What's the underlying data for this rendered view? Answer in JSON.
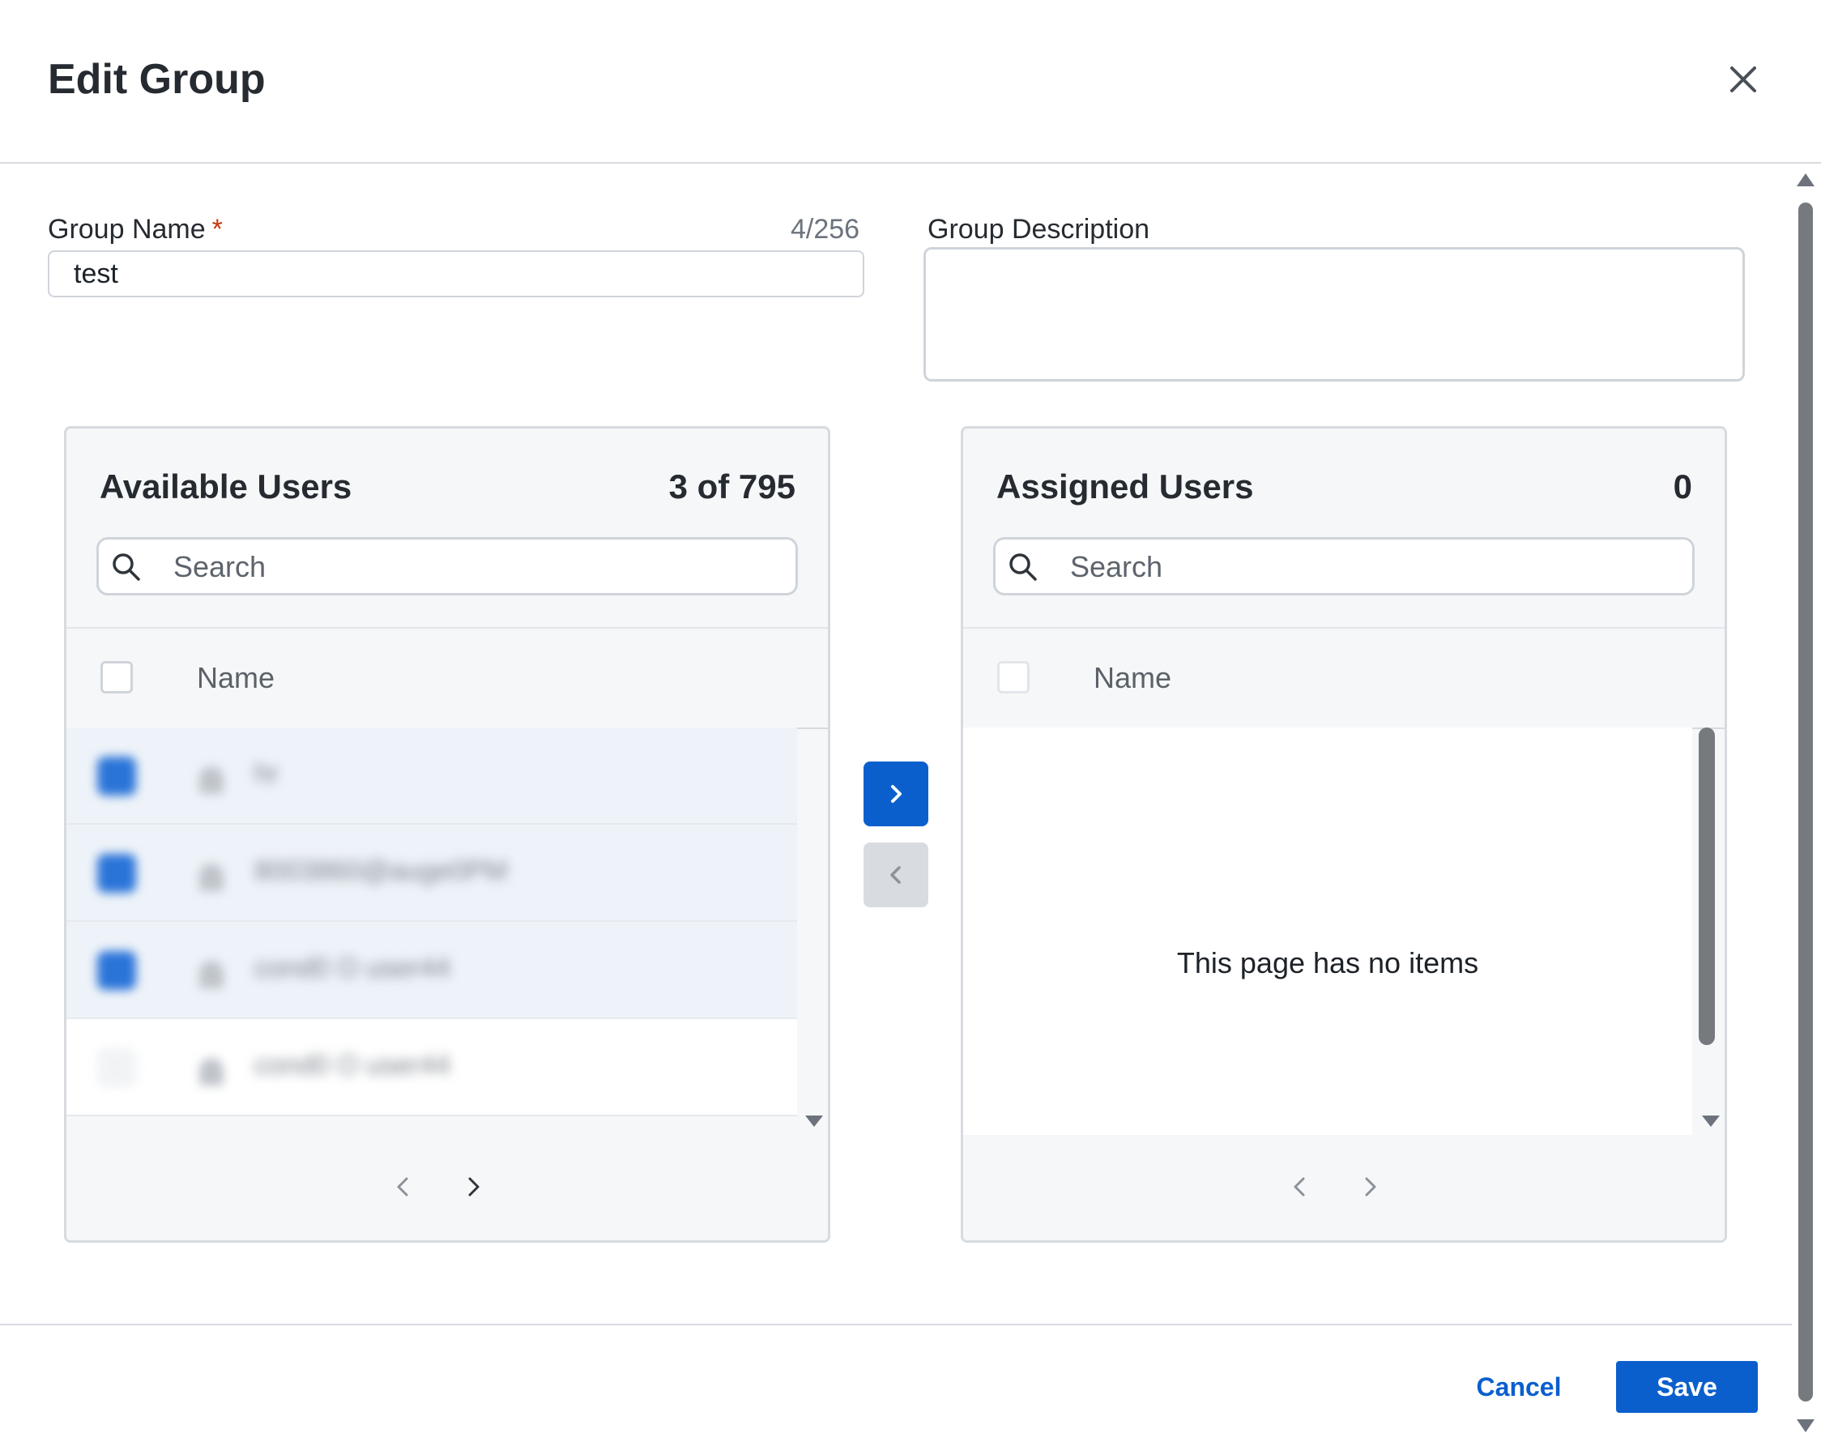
{
  "dialog": {
    "title": "Edit Group",
    "close_icon": "close-icon"
  },
  "form": {
    "group_name_label": "Group Name",
    "required_mark": "*",
    "group_name_value": "test",
    "group_name_counter": "4/256",
    "group_description_label": "Group Description",
    "group_description_value": ""
  },
  "available_users": {
    "title": "Available Users",
    "count": "3 of 795",
    "search_placeholder": "Search",
    "search_icon": "search-icon",
    "column_name": "Name",
    "rows": [
      {
        "name": "hr",
        "selected": true
      },
      {
        "name": "8003860@auge0PM",
        "selected": true
      },
      {
        "name": "cond0 O user44",
        "selected": true
      },
      {
        "name": "cond0 O user44",
        "selected": false
      }
    ]
  },
  "transfer": {
    "move_right_icon": "chevron-right-icon",
    "move_left_icon": "chevron-left-icon"
  },
  "assigned_users": {
    "title": "Assigned Users",
    "count": "0",
    "search_placeholder": "Search",
    "search_icon": "search-icon",
    "column_name": "Name",
    "empty_message": "This page has no items"
  },
  "footer": {
    "cancel_label": "Cancel",
    "save_label": "Save"
  },
  "colors": {
    "primary": "#0b5fcd",
    "required": "#c9360e",
    "selected_row": "#eef3f9"
  }
}
